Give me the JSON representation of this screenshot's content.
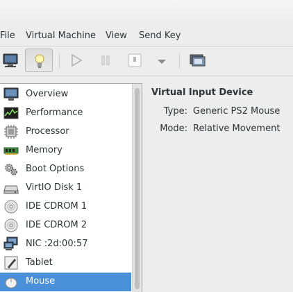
{
  "menu": {
    "file": "File",
    "virtual_machine": "Virtual Machine",
    "view": "View",
    "send_key": "Send Key"
  },
  "toolbar": {
    "buttons": [
      "console-monitor-icon",
      "lightbulb-icon",
      "play-icon",
      "pause-icon",
      "power-icon",
      "dropdown-arrow-icon",
      "snapshots-icon"
    ],
    "pressed": "lightbulb-icon"
  },
  "sidebar": {
    "items": [
      {
        "label": "Overview",
        "icon": "overview-monitor-icon"
      },
      {
        "label": "Performance",
        "icon": "performance-graph-icon"
      },
      {
        "label": "Processor",
        "icon": "processor-chip-icon"
      },
      {
        "label": "Memory",
        "icon": "memory-module-icon"
      },
      {
        "label": "Boot Options",
        "icon": "boot-gears-icon"
      },
      {
        "label": "VirtIO Disk 1",
        "icon": "hard-disk-icon"
      },
      {
        "label": "IDE CDROM 1",
        "icon": "cdrom-icon"
      },
      {
        "label": "IDE CDROM 2",
        "icon": "cdrom-icon"
      },
      {
        "label": "NIC :2d:00:57",
        "icon": "network-icon"
      },
      {
        "label": "Tablet",
        "icon": "tablet-icon"
      },
      {
        "label": "Mouse",
        "icon": "mouse-icon"
      }
    ],
    "selected": "Mouse"
  },
  "details": {
    "title": "Virtual Input Device",
    "type_label": "Type:",
    "type_value": "Generic PS2 Mouse",
    "mode_label": "Mode:",
    "mode_value": "Relative Movement"
  },
  "colors": {
    "selection": "#4a90d9",
    "background": "#ededed"
  }
}
